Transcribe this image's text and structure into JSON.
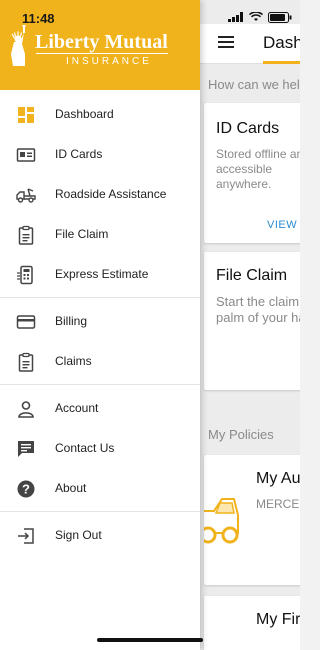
{
  "status_bar": {
    "time": "11:48"
  },
  "brand": {
    "name": "Liberty Mutual",
    "sub": "INSURANCE"
  },
  "drawer": {
    "items": [
      {
        "label": "Dashboard",
        "icon": "dashboard-icon"
      },
      {
        "label": "ID Cards",
        "icon": "id-card-icon"
      },
      {
        "label": "Roadside Assistance",
        "icon": "tow-truck-icon"
      },
      {
        "label": "File Claim",
        "icon": "clipboard-icon"
      },
      {
        "label": "Express Estimate",
        "icon": "phone-estimate-icon"
      },
      {
        "label": "Billing",
        "icon": "credit-card-icon"
      },
      {
        "label": "Claims",
        "icon": "clipboard-icon"
      },
      {
        "label": "Account",
        "icon": "person-icon"
      },
      {
        "label": "Contact Us",
        "icon": "chat-icon"
      },
      {
        "label": "About",
        "icon": "help-icon"
      },
      {
        "label": "Sign Out",
        "icon": "sign-out-icon"
      }
    ]
  },
  "header": {
    "title": "Dash"
  },
  "main": {
    "help_prompt": "How can we hel",
    "id_cards": {
      "title": "ID Cards",
      "body": "Stored offline and accessible anywhere.",
      "link": "VIEW C"
    },
    "file_claim": {
      "title": "File Claim",
      "body": "Start the claim palm of your ha"
    },
    "policies_label": "My Policies",
    "auto_policy": {
      "title": "My Au",
      "subtitle": "MERCE"
    },
    "other_policy": {
      "title": "My Fir"
    }
  },
  "colors": {
    "brand_yellow": "#f1b31b",
    "link_blue": "#2b8bd2"
  }
}
